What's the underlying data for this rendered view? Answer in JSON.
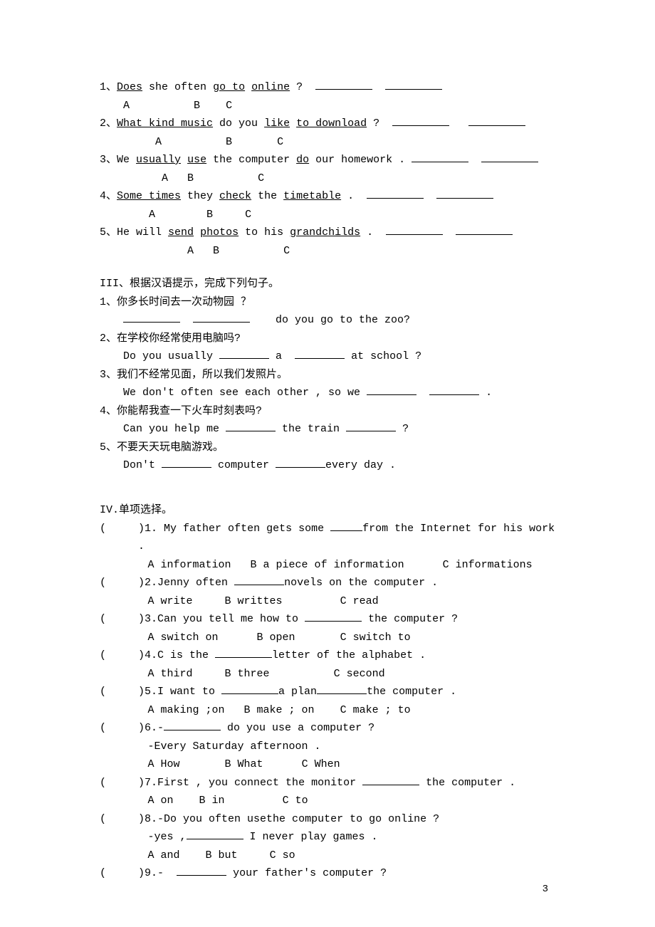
{
  "sec2": {
    "q1": {
      "num": "1、",
      "pre": "",
      "a": "Does",
      "mid1": " she often ",
      "b": "go to",
      "mid2": " ",
      "c": "online",
      "post": " ?"
    },
    "q2": {
      "num": "2、",
      "a": "What kind music",
      "mid1": " do you ",
      "b": "like",
      "mid2": " ",
      "c": "to download",
      "post": " ?"
    },
    "q3": {
      "num": "3、",
      "pre": "We ",
      "a": "usually",
      "mid1": " ",
      "b": "use",
      "mid2": " the computer ",
      "c": "do",
      "post": " our homework ."
    },
    "q4": {
      "num": "4、",
      "a": "Some times",
      "mid1": " they ",
      "b": "check",
      "mid2": " the ",
      "c": "timetable",
      "post": " ."
    },
    "q5": {
      "num": "5、",
      "pre": "He will ",
      "a": "send",
      "mid1": " ",
      "b": "photos",
      "mid2": " to his ",
      "c": "grandchilds",
      "post": " ."
    },
    "abc": {
      "a": "A",
      "b": "B",
      "c": "C"
    }
  },
  "sec3": {
    "title": "III、根据汉语提示，完成下列句子。",
    "q1": {
      "num": "1、",
      "zh": "你多长时间去一次动物园 ？",
      "en_tail": " do you go to the zoo?"
    },
    "q2": {
      "num": "2、",
      "zh": "在学校你经常使用电脑吗?",
      "en_pre": "Do you usually ",
      "en_mid": " a ",
      "en_post": " at school ?"
    },
    "q3": {
      "num": "3、",
      "zh": "我们不经常见面，所以我们发照片。",
      "en_pre": "We don't often see each other , so we ",
      "en_post": " ."
    },
    "q4": {
      "num": "4、",
      "zh": "你能帮我查一下火车时刻表吗?",
      "en_pre": "Can you help me ",
      "en_mid": " the train ",
      "en_post": " ?"
    },
    "q5": {
      "num": "5、",
      "zh": "不要天天玩电脑游戏。",
      "en_pre": "Don't ",
      "en_mid": " computer ",
      "en_post": "every day ."
    }
  },
  "sec4": {
    "title": "IV.单项选择。",
    "q1": {
      "n": ")1.",
      "stem_pre": "My father often gets some ",
      "stem_post": "from the Internet for his work .",
      "a": "A information",
      "b": "B a piece of information",
      "c": "C  informations"
    },
    "q2": {
      "n": ")2.",
      "stem_pre": "Jenny often ",
      "stem_post": "novels on the computer .",
      "a": "A  write",
      "b": "B  writtes",
      "c": "C   read"
    },
    "q3": {
      "n": ")3.",
      "stem_pre": "Can you tell me how to ",
      "stem_post": " the computer ?",
      "a": "A  switch on",
      "b": "B  open",
      "c": "C  switch to"
    },
    "q4": {
      "n": ")4.",
      "stem_pre": "C is the ",
      "stem_post": "letter of the alphabet .",
      "a": "A  third",
      "b": "B  three",
      "c": "C  second"
    },
    "q5": {
      "n": ")5.",
      "stem_pre": "I want to  ",
      "stem_mid": "a plan",
      "stem_post": "the computer .",
      "a": "A  making ;on",
      "b": "B  make ; on",
      "c": "C  make ; to"
    },
    "q6": {
      "n": ")6.",
      "stem_pre": "-",
      "stem_post": " do you use a computer ?",
      "line2": "-Every Saturday afternoon .",
      "a": "A  How",
      "b": "B  What",
      "c": "C  When"
    },
    "q7": {
      "n": ")7.",
      "stem_pre": "First , you connect the monitor  ",
      "stem_post": " the computer .",
      "a": "A  on",
      "b": "B  in",
      "c": "C  to"
    },
    "q8": {
      "n": ")8.",
      "stem_pre": "-Do you often usethe computer to go online ?",
      "line2_pre": "-yes ,",
      "line2_post": " I never play games .",
      "a": "A  and",
      "b": "B  but",
      "c": "C  so"
    },
    "q9": {
      "n": ")9.",
      "stem_pre": "- ",
      "stem_post": " your father's computer ?"
    }
  },
  "page_number": "3"
}
